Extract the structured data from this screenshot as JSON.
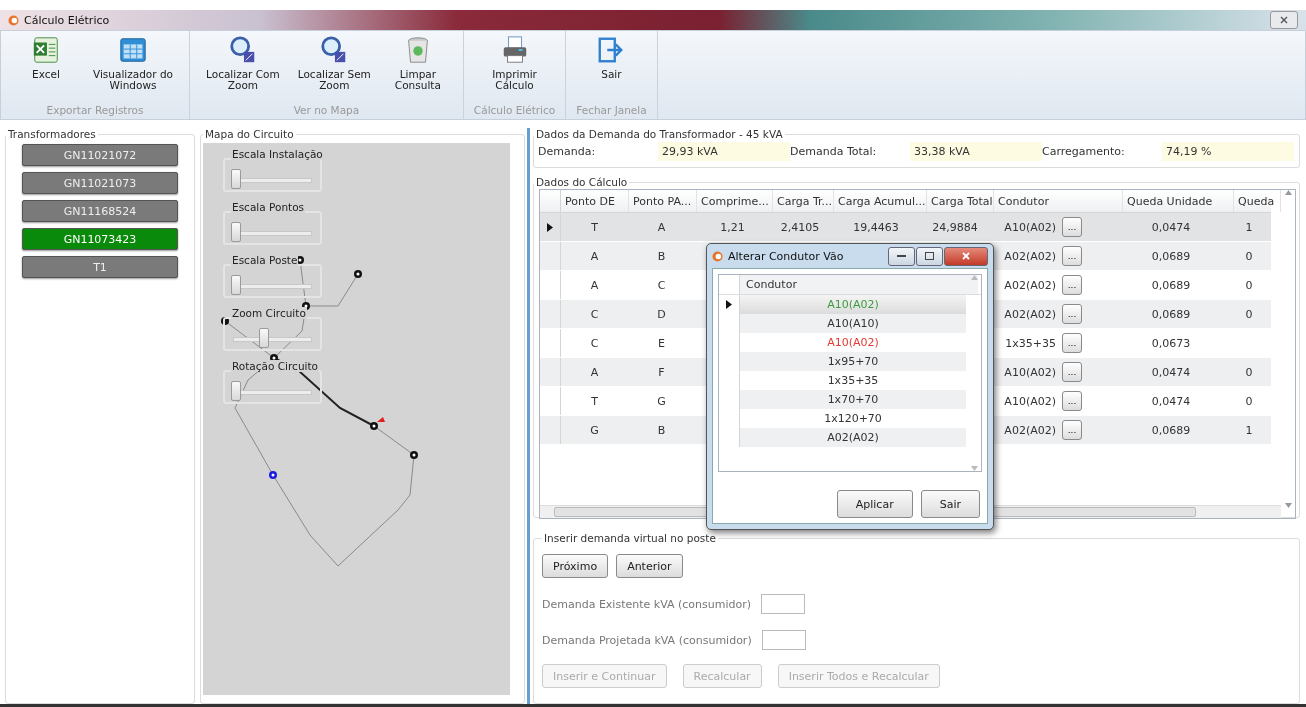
{
  "window": {
    "title": "Cálculo Elétrico"
  },
  "ribbon": {
    "groups": [
      {
        "label": "Exportar Registros",
        "buttons": [
          {
            "label": "Excel",
            "kind": "excel"
          },
          {
            "label": "Visualizador do\nWindows",
            "kind": "viewer"
          }
        ]
      },
      {
        "label": "Ver no Mapa",
        "buttons": [
          {
            "label": "Localizar Com\nZoom",
            "kind": "search"
          },
          {
            "label": "Localizar Sem\nZoom",
            "kind": "search"
          },
          {
            "label": "Limpar\nConsulta",
            "kind": "trash"
          }
        ]
      },
      {
        "label": "Cálculo Elétrico",
        "buttons": [
          {
            "label": "Imprimir\nCálculo",
            "kind": "printer"
          }
        ]
      },
      {
        "label": "Fechar Janela",
        "buttons": [
          {
            "label": "Sair",
            "kind": "exit"
          }
        ]
      }
    ]
  },
  "transformers": {
    "title": "Transformadores",
    "items": [
      {
        "label": "GN11021072",
        "selected": false
      },
      {
        "label": "GN11021073",
        "selected": false
      },
      {
        "label": "GN11168524",
        "selected": false
      },
      {
        "label": "GN11073423",
        "selected": true
      },
      {
        "label": "T1",
        "selected": false
      }
    ]
  },
  "map": {
    "title": "Mapa do Circuito",
    "sliders": [
      {
        "label": "Escala Instalação",
        "level": 0
      },
      {
        "label": "Escala Pontos",
        "level": 0
      },
      {
        "label": "Escala Poste",
        "level": 0
      },
      {
        "label": "Zoom Circuito",
        "level": 0.35
      },
      {
        "label": "Rotação Circuito",
        "level": 0
      }
    ],
    "nodes": [
      {
        "color": "#111111"
      },
      {
        "color": "#111111"
      },
      {
        "color": "#111111"
      },
      {
        "color": "#111111"
      },
      {
        "color": "#111111"
      },
      {
        "color": "#111111"
      },
      {
        "color": "#1a1ae0"
      }
    ]
  },
  "demand": {
    "title": "Dados da Demanda do Transformador - 45 kVA",
    "fields": [
      {
        "label": "Demanda:",
        "value": "29,93 kVA"
      },
      {
        "label": "Demanda Total:",
        "value": "33,38 kVA"
      },
      {
        "label": "Carregamento:",
        "value": "74,19 %"
      }
    ]
  },
  "calc": {
    "title": "Dados do Cálculo",
    "columns": [
      "Ponto DE",
      "Ponto PA...",
      "Comprime...",
      "Carga Tr...",
      "Carga Acumul...",
      "Carga Total",
      "Condutor",
      "Queda Unidade",
      "Queda"
    ],
    "rows": [
      {
        "selected": true,
        "cells": [
          "T",
          "A",
          "1,21",
          "2,4105",
          "19,4463",
          "24,9884",
          "A10(A02)",
          "0,0474",
          "1"
        ],
        "edit_button": "..."
      },
      {
        "selected": false,
        "cells": [
          "A",
          "B",
          "",
          "",
          "",
          "",
          "A02(A02)",
          "0,0689",
          "0"
        ],
        "edit_button": "..."
      },
      {
        "selected": false,
        "cells": [
          "A",
          "C",
          "",
          "",
          "",
          "",
          "A02(A02)",
          "0,0689",
          "0"
        ],
        "edit_button": "..."
      },
      {
        "selected": false,
        "cells": [
          "C",
          "D",
          "",
          "",
          "",
          "",
          "A02(A02)",
          "0,0689",
          "0"
        ],
        "edit_button": "..."
      },
      {
        "selected": false,
        "cells": [
          "C",
          "E",
          "",
          "",
          "",
          "",
          "1x35+35",
          "0,0673",
          ""
        ],
        "edit_button": "..."
      },
      {
        "selected": false,
        "cells": [
          "A",
          "F",
          "",
          "",
          "",
          "",
          "A10(A02)",
          "0,0474",
          "0"
        ],
        "edit_button": "..."
      },
      {
        "selected": false,
        "cells": [
          "T",
          "G",
          "",
          "",
          "",
          "",
          "A10(A02)",
          "0,0474",
          "0"
        ],
        "edit_button": "..."
      },
      {
        "selected": false,
        "cells": [
          "G",
          "B",
          "",
          "",
          "",
          "",
          "A02(A02)",
          "0,0689",
          "1"
        ],
        "edit_button": "..."
      }
    ]
  },
  "dialog": {
    "title": "Alterar Condutor Vão",
    "column": "Condutor",
    "items": [
      {
        "label": "A10(A02)",
        "selected": true,
        "color": "#3f9a3f"
      },
      {
        "label": "A10(A10)",
        "selected": false,
        "color": "#333333"
      },
      {
        "label": "A10(A02)",
        "selected": false,
        "color": "#e53935"
      },
      {
        "label": "1x95+70",
        "selected": false,
        "color": "#333333"
      },
      {
        "label": "1x35+35",
        "selected": false,
        "color": "#333333"
      },
      {
        "label": "1x70+70",
        "selected": false,
        "color": "#333333"
      },
      {
        "label": "1x120+70",
        "selected": false,
        "color": "#333333"
      },
      {
        "label": "A02(A02)",
        "selected": false,
        "color": "#333333"
      }
    ],
    "buttons": [
      "Aplicar",
      "Sair"
    ]
  },
  "virtual": {
    "title": "Inserir demanda virtual no poste",
    "nav_buttons": [
      "Próximo",
      "Anterior"
    ],
    "fields": [
      {
        "label": "Demanda Existente kVA (consumidor)"
      },
      {
        "label": "Demanda Projetada kVA (consumidor)"
      }
    ],
    "actions": [
      {
        "label": "Inserir e Continuar",
        "disabled": true
      },
      {
        "label": "Recalcular",
        "disabled": true
      },
      {
        "label": "Inserir Todos e Recalcular",
        "disabled": true
      }
    ]
  }
}
